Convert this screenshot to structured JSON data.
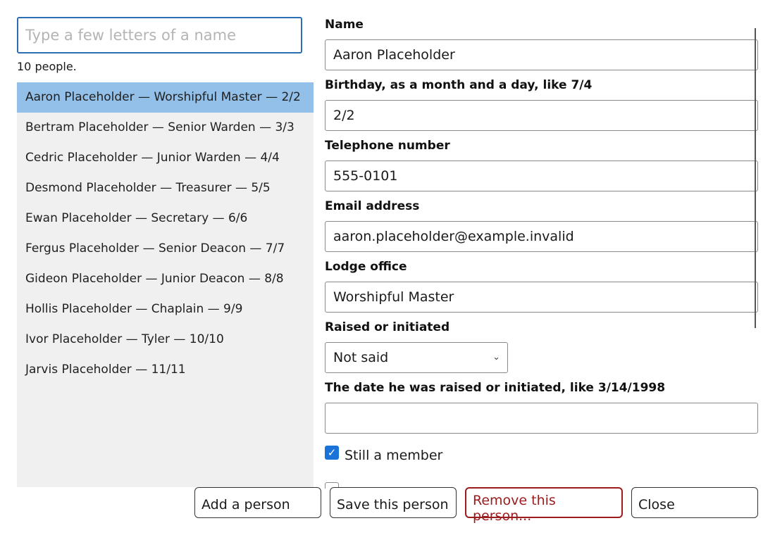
{
  "search": {
    "placeholder": "Type a few letters of a name",
    "value": ""
  },
  "count_text": "10 people.",
  "people": [
    "Aaron Placeholder — Worshipful Master — 2/2",
    "Bertram Placeholder — Senior Warden — 3/3",
    "Cedric Placeholder — Junior Warden — 4/4",
    "Desmond Placeholder — Treasurer — 5/5",
    "Ewan Placeholder — Secretary — 6/6",
    "Fergus Placeholder — Senior Deacon — 7/7",
    "Gideon Placeholder — Junior Deacon — 8/8",
    "Hollis Placeholder — Chaplain — 9/9",
    "Ivor Placeholder — Tyler — 10/10",
    "Jarvis Placeholder — 11/11"
  ],
  "selected_index": 0,
  "form": {
    "name_label": "Name",
    "name_value": "Aaron Placeholder",
    "birthday_label": "Birthday, as a month and a day, like 7/4",
    "birthday_value": "2/2",
    "phone_label": "Telephone number",
    "phone_value": "555-0101",
    "email_label": "Email address",
    "email_value": "aaron.placeholder@example.invalid",
    "office_label": "Lodge office",
    "office_value": "Worshipful Master",
    "raised_label": "Raised or initiated",
    "raised_value": "Not said",
    "raised_date_label": "The date he was raised or initiated, like 3/14/1998",
    "raised_date_value": "",
    "member_label": "Still a member",
    "member_checked": true
  },
  "buttons": {
    "add": "Add a person",
    "save": "Save this person",
    "remove": "Remove this person...",
    "close": "Close"
  },
  "colors": {
    "selected_row": "#93c0e8",
    "danger": "#9b1c1c",
    "checkbox": "#1a73d9",
    "focus": "#2a6fb3"
  },
  "icons": {
    "select": "chevron-down-icon",
    "checkbox": "checkmark-icon"
  }
}
